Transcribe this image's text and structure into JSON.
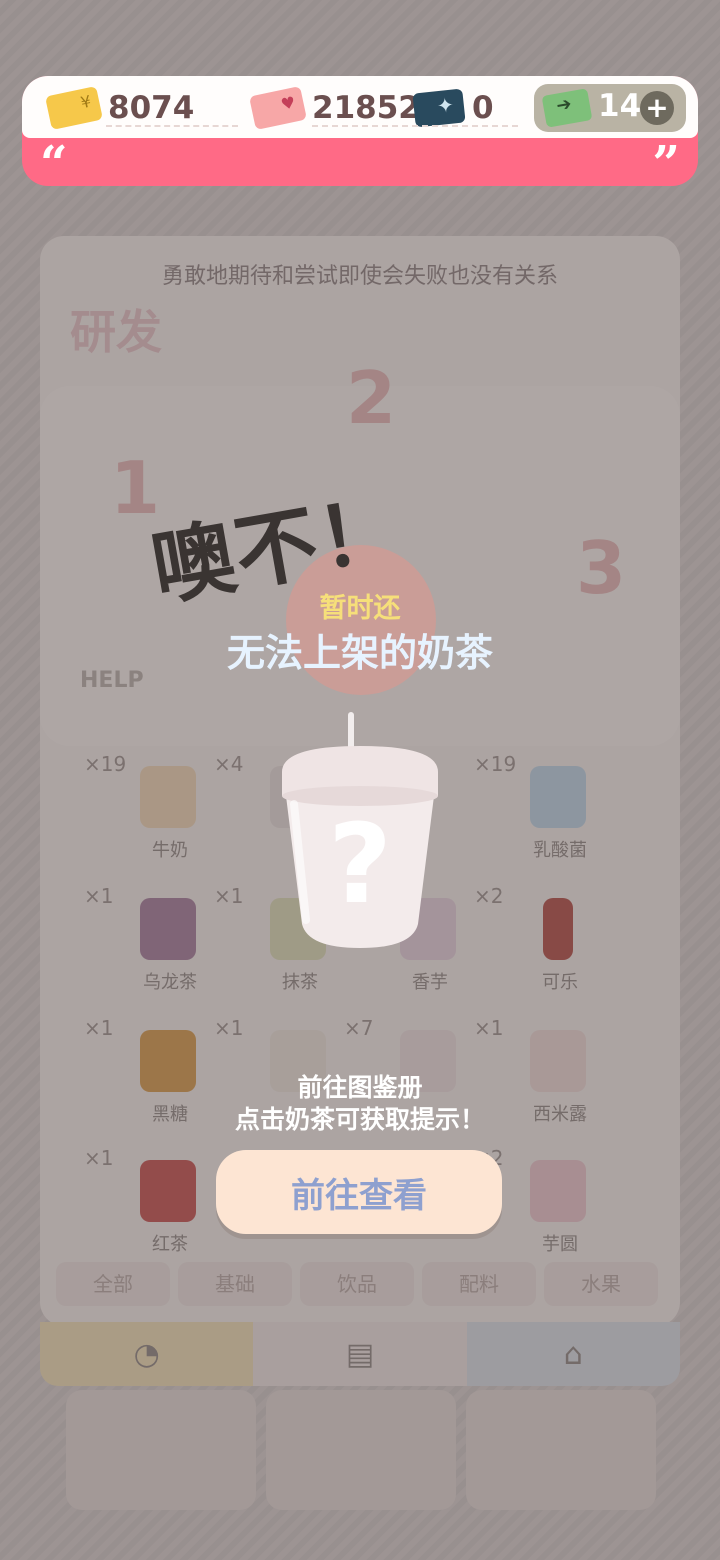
{
  "resources": {
    "gold_coins": "8074",
    "love_coins": "21852",
    "blue_cards": "0",
    "tickets": "14",
    "plus": "+"
  },
  "banner": {
    "open_quote": "“",
    "close_quote": "”"
  },
  "background": {
    "quote": "勇敢地期待和尝试即使会失败也没有关系",
    "level_label": "研发",
    "help": "HELP",
    "numbers": [
      "1",
      "2",
      "3"
    ],
    "ingredients": [
      {
        "count": "×19",
        "label": "牛奶"
      },
      {
        "count": "×4",
        "label": ""
      },
      {
        "count": "×19",
        "label": "乳酸菌"
      },
      {
        "count": "×1",
        "label": "乌龙茶"
      },
      {
        "count": "×1",
        "label": "抹茶"
      },
      {
        "count": "",
        "label": "香芋"
      },
      {
        "count": "×2",
        "label": "可乐"
      },
      {
        "count": "×1",
        "label": "黑糖"
      },
      {
        "count": "×1",
        "label": ""
      },
      {
        "count": "×7",
        "label": ""
      },
      {
        "count": "×1",
        "label": "西米露"
      },
      {
        "count": "×1",
        "label": "红茶"
      },
      {
        "count": "×2",
        "label": "芋圆"
      }
    ],
    "categories": [
      "全部",
      "基础",
      "饮品",
      "配料",
      "水果"
    ]
  },
  "popup": {
    "headline": "噢不！",
    "sub_small": "暂时还",
    "sub_big": "无法上架的奶茶",
    "question_mark": "?",
    "hint_line1": "前往图鉴册",
    "hint_line2": "点击奶茶可获取提示！",
    "button_label": "前往查看"
  },
  "colors": {
    "banner_pink": "#ff6a86",
    "button_bg": "#fde5d3",
    "button_text": "#8ea0cf",
    "sub_small": "#f6df7a",
    "sub_big": "#e7f3ff"
  }
}
